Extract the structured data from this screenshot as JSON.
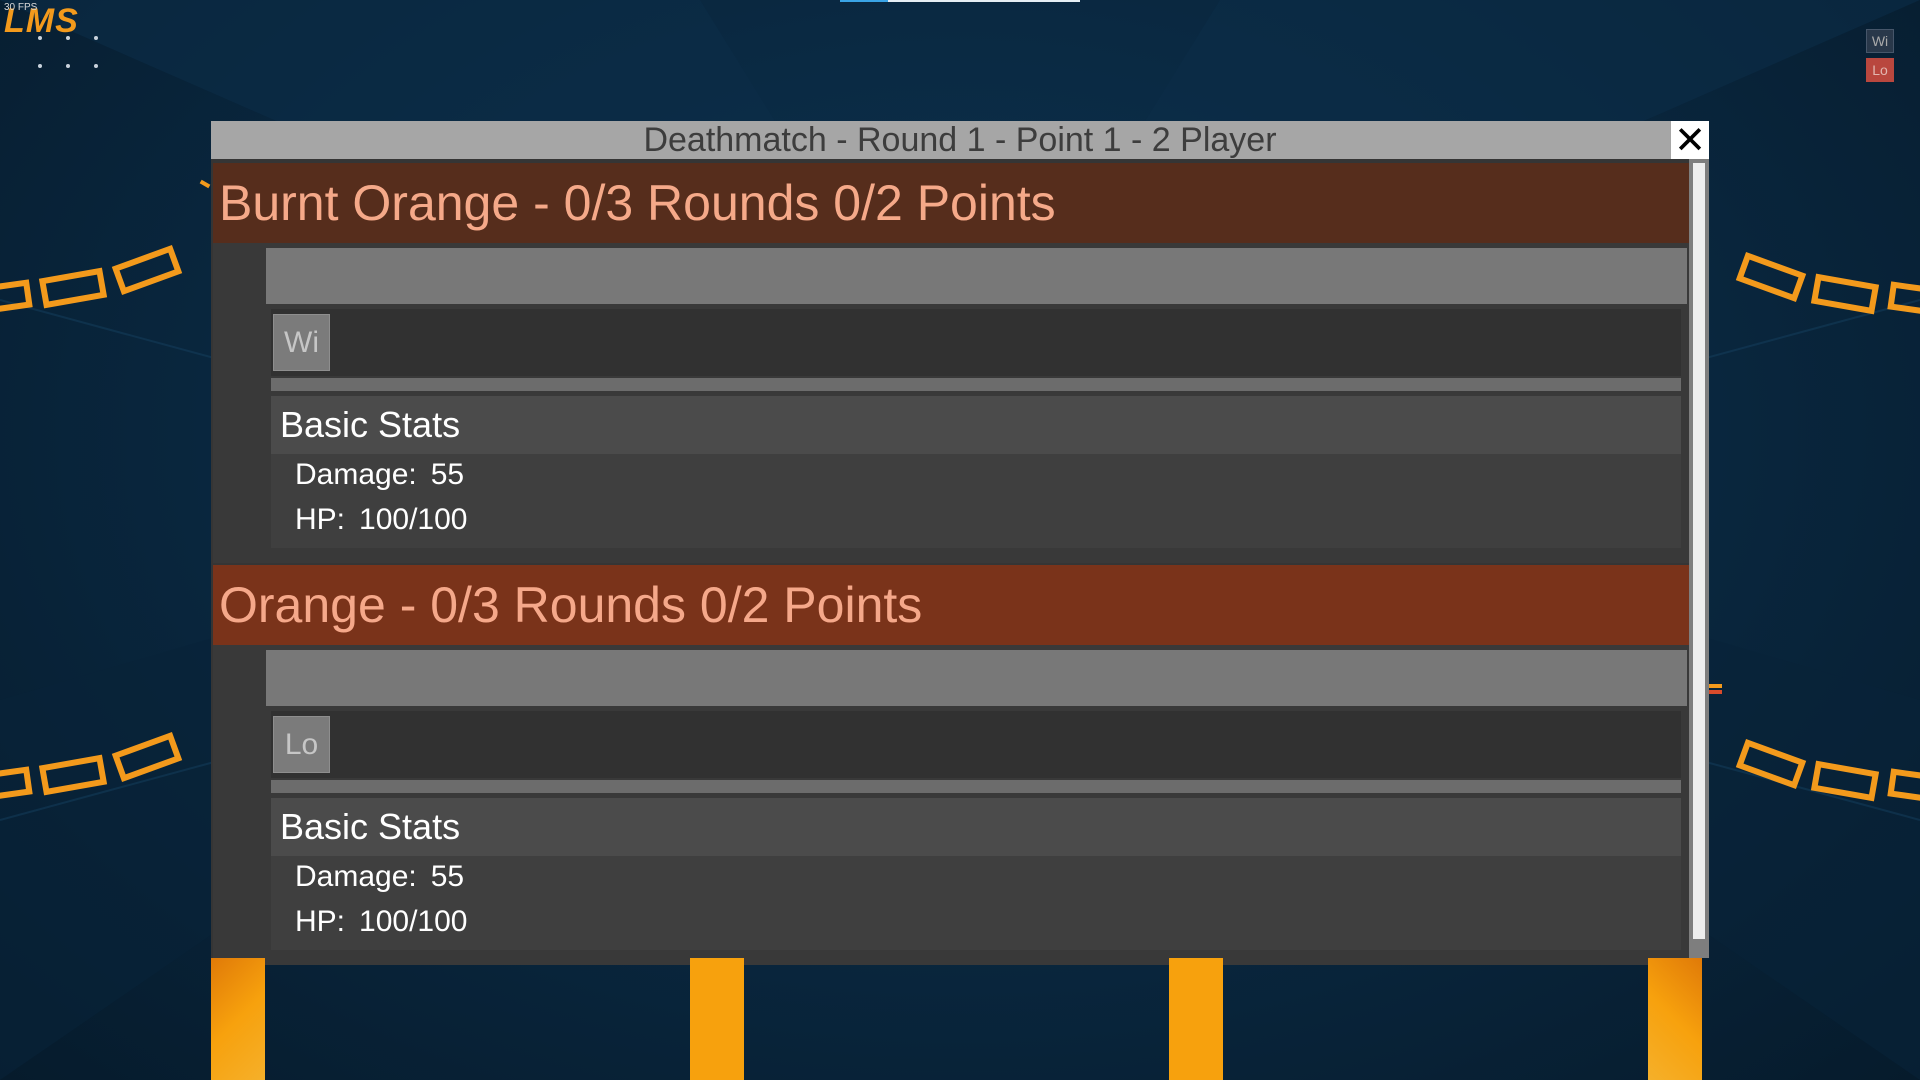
{
  "hud": {
    "fps_text": "30 FPS",
    "logo_text": "LMS",
    "corner_badges": [
      "Wi",
      "Lo"
    ]
  },
  "dialog": {
    "title": "Deathmatch - Round 1 - Point 1 - 2 Player",
    "close_icon": "close-icon"
  },
  "players": [
    {
      "name": "Burnt Orange",
      "separator": "-",
      "rounds": "0/3 Rounds",
      "points": "0/2 Points",
      "color": "#562d1c",
      "text_color": "#f5a989",
      "slot_label": "Wi",
      "stats_title": "Basic Stats",
      "stats": [
        {
          "label": "Damage:",
          "value": "55"
        },
        {
          "label": "HP:",
          "value": "100/100"
        }
      ]
    },
    {
      "name": "Orange",
      "separator": "-",
      "rounds": "0/3 Rounds",
      "points": "0/2 Points",
      "color": "#7a331a",
      "text_color": "#f5a88a",
      "slot_label": "Lo",
      "stats_title": "Basic Stats",
      "stats": [
        {
          "label": "Damage:",
          "value": "55"
        },
        {
          "label": "HP:",
          "value": "100/100"
        }
      ]
    }
  ],
  "colors": {
    "background": "#0a2942",
    "chain_link": "#f39a1c",
    "pillar": "#f7a10d"
  }
}
